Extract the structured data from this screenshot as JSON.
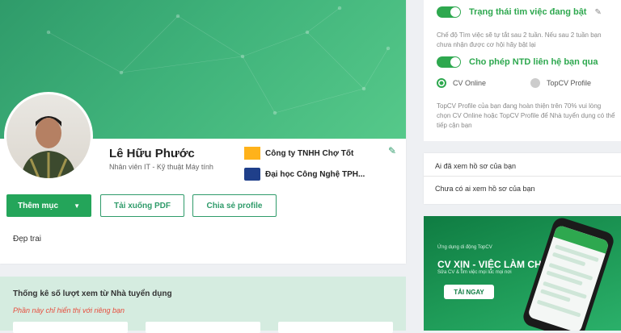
{
  "colors": {
    "brand_green": "#2ea84f",
    "accent_green": "#24a55a",
    "note_red": "#e74c3c",
    "stats_bg": "#d5ece0"
  },
  "profile": {
    "name": "Lê Hữu Phước",
    "title": "Nhân viên IT - Kỹ thuật Máy tính",
    "company": "Công ty TNHH Chợ Tốt",
    "school": "Đại học Công Nghệ TPH...",
    "bio": "Đẹp trai",
    "icons": {
      "edit": "pencil-icon",
      "company_logo": "company-logo-icon",
      "school_logo": "school-logo-icon",
      "dropdown": "caret-down-icon"
    }
  },
  "actions": {
    "add_label": "Thêm mục",
    "download_label": "Tải xuống PDF",
    "share_label": "Chia sẻ profile"
  },
  "stats": {
    "title": "Thống kê số lượt xem từ Nhà tuyển dụng",
    "note": "Phần này chỉ hiển thị với riêng bạn"
  },
  "settings": {
    "job_status_label": "Trạng thái tìm việc đang bật",
    "job_status_desc": "Chế độ Tìm việc sẽ tự tắt sau 2 tuần. Nếu sau 2 tuần bạn chưa nhận được cơ hội hãy bật lại",
    "allow_contact_label": "Cho phép NTD liên hệ bạn qua",
    "option_cv": "CV Online",
    "option_topcv": "TopCV Profile",
    "profile_desc": "TopCV Profile của bạn đang hoàn thiện trên 70% vui lòng chọn CV Online hoặc TopCV Profile để Nhà tuyển dụng có thể tiếp cận bạn"
  },
  "viewers": {
    "title": "Ai đã xem hồ sơ của bạn",
    "empty": "Chưa có ai xem hồ sơ của bạn"
  },
  "banner": {
    "kicker": "Ứng dụng di động TopCV",
    "title": "CV XỊN - VIỆC LÀM CHẤT",
    "subtitle": "Sửa CV & tìm việc mọi lúc mọi nơi",
    "button": "TẢI NGAY"
  }
}
